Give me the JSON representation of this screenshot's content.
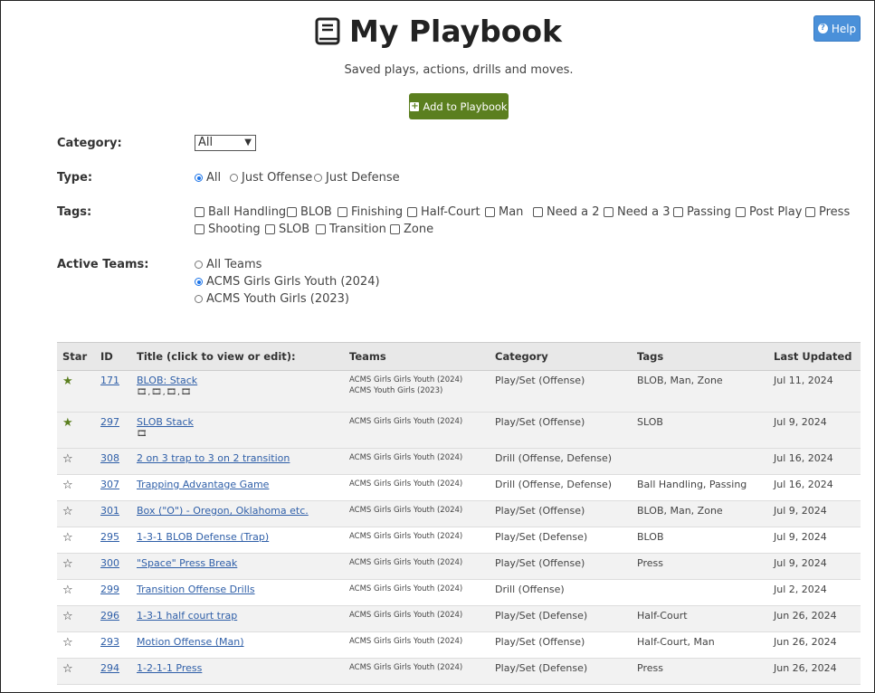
{
  "help_label": "Help",
  "title": "My Playbook",
  "subtitle": "Saved plays, actions, drills and moves.",
  "add_label": "Add to Playbook",
  "category": {
    "label": "Category:",
    "value": "All"
  },
  "type": {
    "label": "Type:",
    "options": [
      "All",
      "Just Offense",
      "Just Defense"
    ]
  },
  "tags": {
    "label": "Tags:",
    "row1": [
      "Ball Handling",
      "BLOB",
      "Finishing",
      "Half-Court",
      "Man",
      "Need a 2",
      "Need a 3",
      "Passing",
      "Post Play",
      "Press"
    ],
    "row2": [
      "Shooting",
      "SLOB",
      "Transition",
      "Zone"
    ]
  },
  "teams": {
    "label": "Active Teams:",
    "options": [
      "All Teams",
      "ACMS Girls Girls Youth (2024)",
      "ACMS Youth Girls (2023)"
    ]
  },
  "columns": [
    "Star",
    "ID",
    "Title (click to view or edit):",
    "Teams",
    "Category",
    "Tags",
    "Last Updated"
  ],
  "rows": [
    {
      "star": "★",
      "id": "171",
      "title": "BLOB: Stack",
      "film": "🎞,🎞,🎞,🎞",
      "team1": "ACMS Girls Girls Youth (2024)",
      "team2": "ACMS Youth Girls (2023)",
      "category": "Play/Set (Offense)",
      "tags": "BLOB, Man, Zone",
      "updated": "Jul 11, 2024"
    },
    {
      "star": "★",
      "id": "297",
      "title": "SLOB Stack",
      "film": "🎞",
      "team1": "ACMS Girls Girls Youth (2024)",
      "team2": "",
      "category": "Play/Set (Offense)",
      "tags": "SLOB",
      "updated": "Jul 9, 2024"
    },
    {
      "star": "☆",
      "id": "308",
      "title": "2 on 3 trap to 3 on 2 transition",
      "film": "",
      "team1": "ACMS Girls Girls Youth (2024)",
      "team2": "",
      "category": "Drill (Offense, Defense)",
      "tags": "",
      "updated": "Jul 16, 2024"
    },
    {
      "star": "☆",
      "id": "307",
      "title": "Trapping Advantage Game",
      "film": "",
      "team1": "ACMS Girls Girls Youth (2024)",
      "team2": "",
      "category": "Drill (Offense, Defense)",
      "tags": "Ball Handling, Passing",
      "updated": "Jul 16, 2024"
    },
    {
      "star": "☆",
      "id": "301",
      "title": "Box (\"O\") - Oregon, Oklahoma etc.",
      "film": "",
      "team1": "ACMS Girls Girls Youth (2024)",
      "team2": "",
      "category": "Play/Set (Offense)",
      "tags": "BLOB, Man, Zone",
      "updated": "Jul 9, 2024"
    },
    {
      "star": "☆",
      "id": "295",
      "title": "1-3-1 BLOB Defense (Trap)",
      "film": "",
      "team1": "ACMS Girls Girls Youth (2024)",
      "team2": "",
      "category": "Play/Set (Defense)",
      "tags": "BLOB",
      "updated": "Jul 9, 2024"
    },
    {
      "star": "☆",
      "id": "300",
      "title": "\"Space\" Press Break",
      "film": "",
      "team1": "ACMS Girls Girls Youth (2024)",
      "team2": "",
      "category": "Play/Set (Offense)",
      "tags": "Press",
      "updated": "Jul 9, 2024"
    },
    {
      "star": "☆",
      "id": "299",
      "title": "Transition Offense Drills",
      "film": "",
      "team1": "ACMS Girls Girls Youth (2024)",
      "team2": "",
      "category": "Drill (Offense)",
      "tags": "",
      "updated": "Jul 2, 2024"
    },
    {
      "star": "☆",
      "id": "296",
      "title": "1-3-1 half court trap",
      "film": "",
      "team1": "ACMS Girls Girls Youth (2024)",
      "team2": "",
      "category": "Play/Set (Defense)",
      "tags": "Half-Court",
      "updated": "Jun 26, 2024"
    },
    {
      "star": "☆",
      "id": "293",
      "title": "Motion Offense (Man)",
      "film": "",
      "team1": "ACMS Girls Girls Youth (2024)",
      "team2": "",
      "category": "Play/Set (Offense)",
      "tags": "Half-Court, Man",
      "updated": "Jun 26, 2024"
    },
    {
      "star": "☆",
      "id": "294",
      "title": "1-2-1-1 Press",
      "film": "",
      "team1": "ACMS Girls Girls Youth (2024)",
      "team2": "",
      "category": "Play/Set (Defense)",
      "tags": "Press",
      "updated": "Jun 26, 2024"
    }
  ]
}
